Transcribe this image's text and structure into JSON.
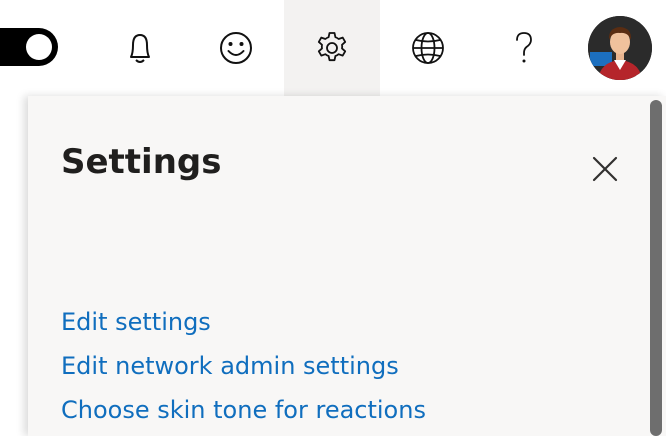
{
  "header": {
    "toggle": {
      "state": "on"
    },
    "icons": [
      {
        "name": "notifications",
        "icon": "bell-icon"
      },
      {
        "name": "feedback",
        "icon": "smiley-icon"
      },
      {
        "name": "settings",
        "icon": "gear-icon",
        "active": true
      },
      {
        "name": "language",
        "icon": "globe-icon"
      },
      {
        "name": "help",
        "icon": "question-icon"
      }
    ],
    "avatar": {
      "icon": "user-avatar"
    }
  },
  "panel": {
    "title": "Settings",
    "close_icon": "close-icon",
    "links": [
      "Edit settings",
      "Edit network admin settings",
      "Choose skin tone for reactions"
    ]
  },
  "colors": {
    "link": "#106ebe",
    "panel_bg": "#f8f7f6",
    "active_icon_bg": "#f3f2f1",
    "title": "#201f1e"
  }
}
